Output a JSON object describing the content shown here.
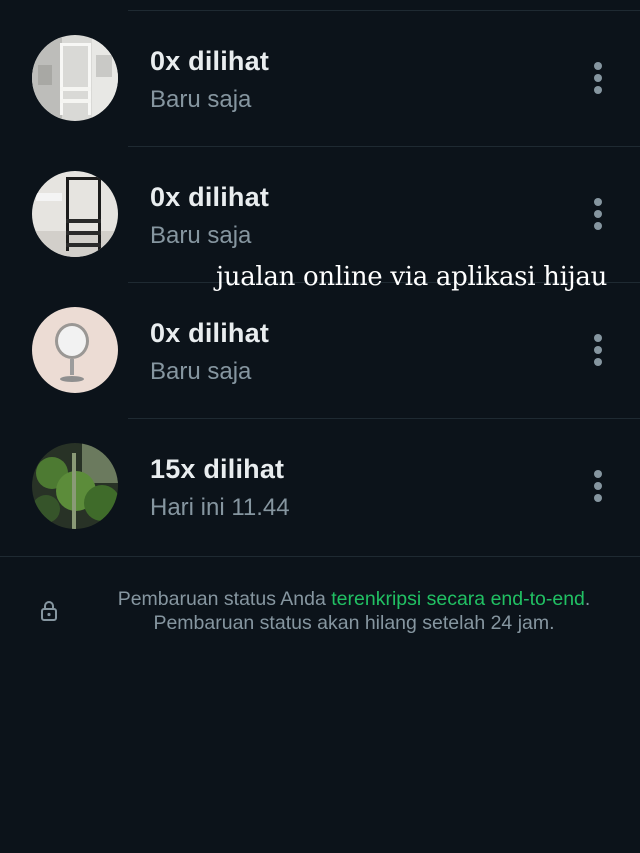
{
  "statuses": [
    {
      "views": "0x dilihat",
      "time": "Baru saja",
      "thumbnail": "white-rack-photo-icon"
    },
    {
      "views": "0x dilihat",
      "time": "Baru saja",
      "thumbnail": "black-rack-photo-icon"
    },
    {
      "views": "0x dilihat",
      "time": "Baru saja",
      "thumbnail": "mirror-photo-icon"
    },
    {
      "views": "15x dilihat",
      "time": "Hari ini 11.44",
      "thumbnail": "plants-photo-icon"
    }
  ],
  "overlay": {
    "caption": "jualan online via aplikasi hijau"
  },
  "footer": {
    "text_before": "Pembaruan status Anda ",
    "link": "terenkripsi secara end-to-end",
    "text_after": ".",
    "line2": "Pembaruan status akan hilang setelah 24 jam.",
    "icon": "lock-icon"
  },
  "colors": {
    "background": "#0c131a",
    "accent": "#21c063",
    "secondary_text": "#8696a0"
  }
}
